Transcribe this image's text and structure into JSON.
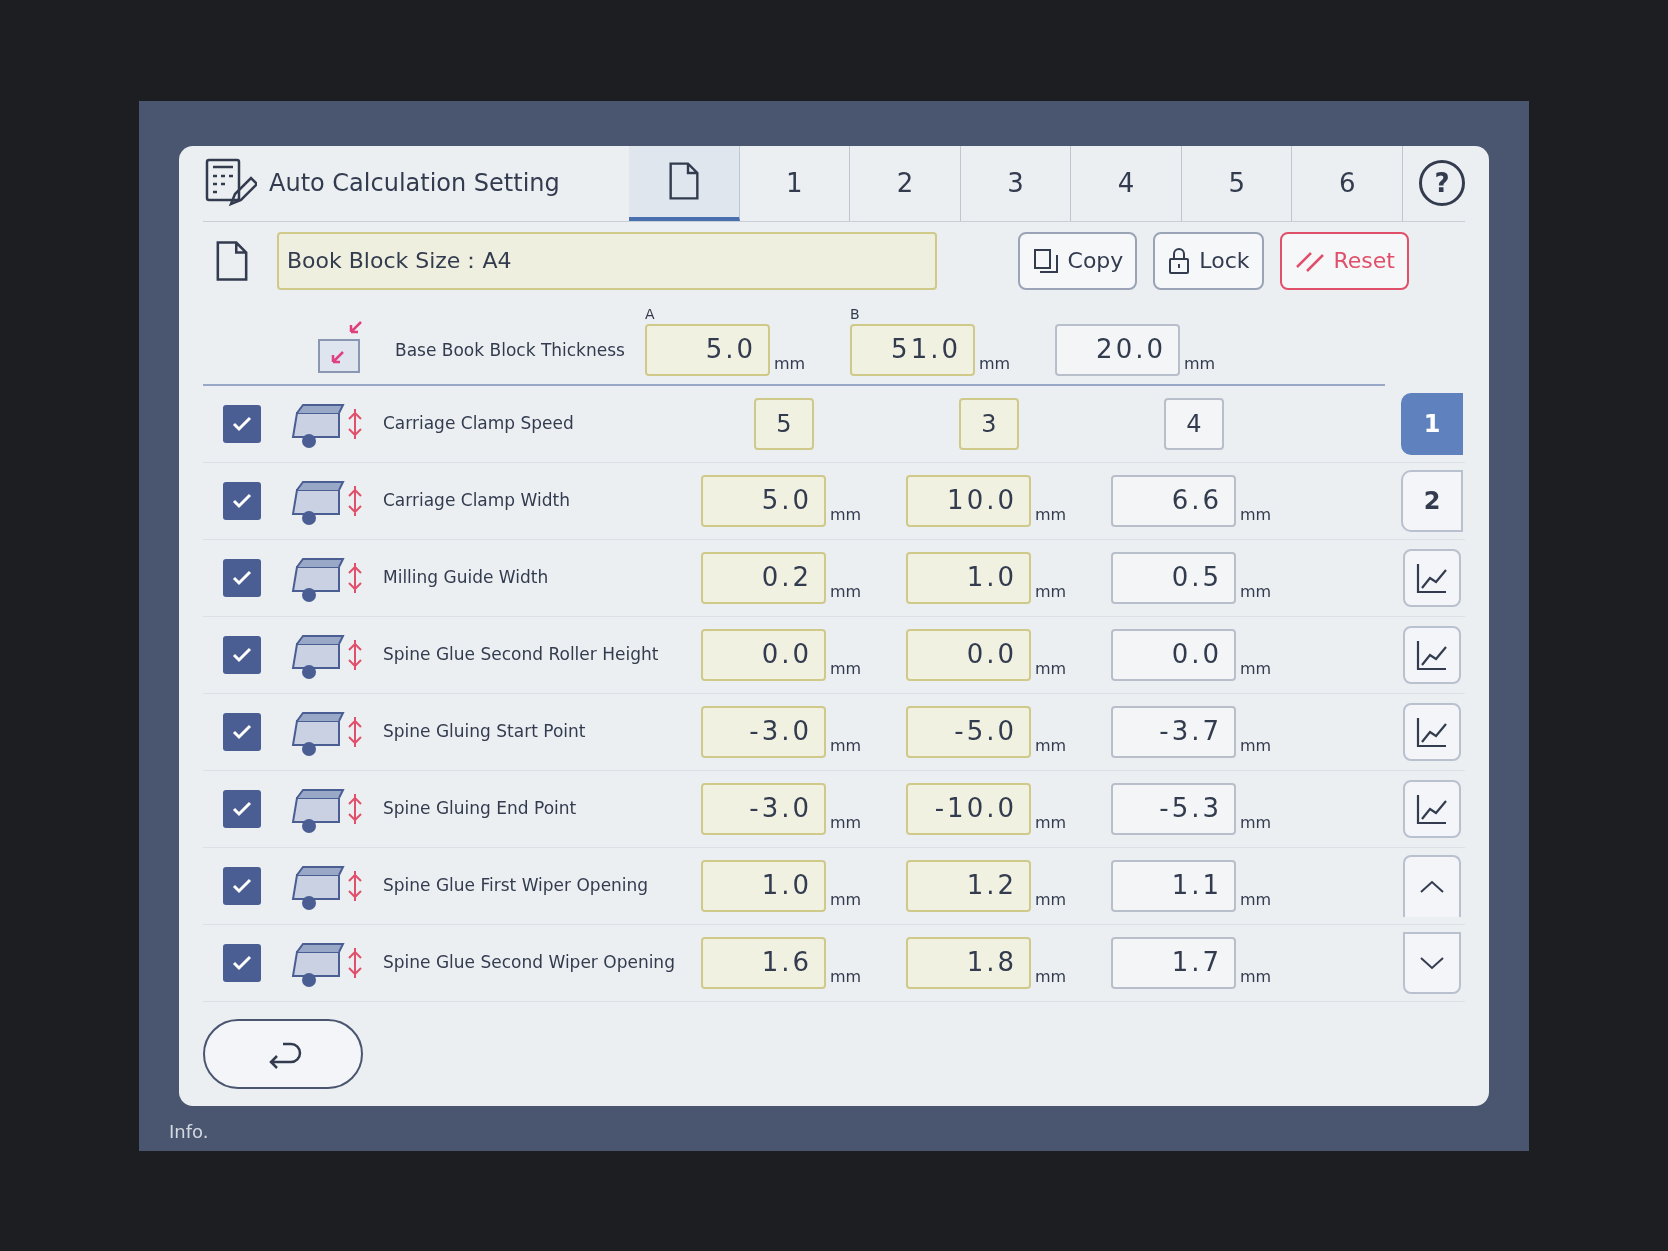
{
  "background": {
    "status_text": "Info."
  },
  "dialog": {
    "title": "Auto Calculation Setting",
    "tabs": [
      {
        "kind": "icon",
        "selected": true
      },
      {
        "kind": "number",
        "label": "1",
        "selected": false
      },
      {
        "kind": "number",
        "label": "2",
        "selected": false
      },
      {
        "kind": "number",
        "label": "3",
        "selected": false
      },
      {
        "kind": "number",
        "label": "4",
        "selected": false
      },
      {
        "kind": "number",
        "label": "5",
        "selected": false
      },
      {
        "kind": "number",
        "label": "6",
        "selected": false
      }
    ],
    "help_label": "?",
    "name_field": "Book Block Size：A4",
    "buttons": [
      {
        "kind": "copy",
        "label": "Copy"
      },
      {
        "kind": "lock",
        "label": "Lock"
      },
      {
        "kind": "reset",
        "label": "Reset"
      }
    ],
    "thickness": {
      "label": "Base Book Block Thickness",
      "columns": [
        {
          "heading": "A",
          "value": "5.0",
          "unit": "mm"
        },
        {
          "heading": "B",
          "value": "51.0",
          "unit": "mm"
        },
        {
          "value": "20.0",
          "unit": "mm"
        }
      ]
    },
    "rows": [
      {
        "label": "Carriage Clamp Speed",
        "checked": true,
        "values": [
          {
            "value": "5"
          },
          {
            "value": "3"
          },
          {
            "value": "4"
          }
        ],
        "side": {
          "kind": "page",
          "label": "1",
          "selected": true
        }
      },
      {
        "label": "Carriage Clamp Width",
        "checked": true,
        "values": [
          {
            "value": "5.0",
            "unit": "mm"
          },
          {
            "value": "10.0",
            "unit": "mm"
          },
          {
            "value": "6.6",
            "unit": "mm"
          }
        ],
        "side": {
          "kind": "page",
          "label": "2",
          "selected": false
        }
      },
      {
        "label": "Milling Guide Width",
        "checked": true,
        "values": [
          {
            "value": "0.2",
            "unit": "mm"
          },
          {
            "value": "1.0",
            "unit": "mm"
          },
          {
            "value": "0.5",
            "unit": "mm"
          }
        ],
        "side": {
          "kind": "chart"
        }
      },
      {
        "label": "Spine Glue Second Roller Height",
        "checked": true,
        "values": [
          {
            "value": "0.0",
            "unit": "mm"
          },
          {
            "value": "0.0",
            "unit": "mm"
          },
          {
            "value": "0.0",
            "unit": "mm"
          }
        ],
        "side": {
          "kind": "chart"
        }
      },
      {
        "label": "Spine Gluing Start Point",
        "checked": true,
        "values": [
          {
            "value": "-3.0",
            "unit": "mm"
          },
          {
            "value": "-5.0",
            "unit": "mm"
          },
          {
            "value": "-3.7",
            "unit": "mm"
          }
        ],
        "side": {
          "kind": "chart"
        }
      },
      {
        "label": "Spine Gluing End Point",
        "checked": true,
        "values": [
          {
            "value": "-3.0",
            "unit": "mm"
          },
          {
            "value": "-10.0",
            "unit": "mm"
          },
          {
            "value": "-5.3",
            "unit": "mm"
          }
        ],
        "side": {
          "kind": "chart"
        }
      },
      {
        "label": "Spine Glue First Wiper Opening",
        "checked": true,
        "values": [
          {
            "value": "1.0",
            "unit": "mm"
          },
          {
            "value": "1.2",
            "unit": "mm"
          },
          {
            "value": "1.1",
            "unit": "mm"
          }
        ],
        "side": {
          "kind": "scroll-up"
        }
      },
      {
        "label": "Spine Glue Second Wiper Opening",
        "checked": true,
        "values": [
          {
            "value": "1.6",
            "unit": "mm"
          },
          {
            "value": "1.8",
            "unit": "mm"
          },
          {
            "value": "1.7",
            "unit": "mm"
          }
        ],
        "side": {
          "kind": "scroll-down"
        }
      }
    ]
  }
}
